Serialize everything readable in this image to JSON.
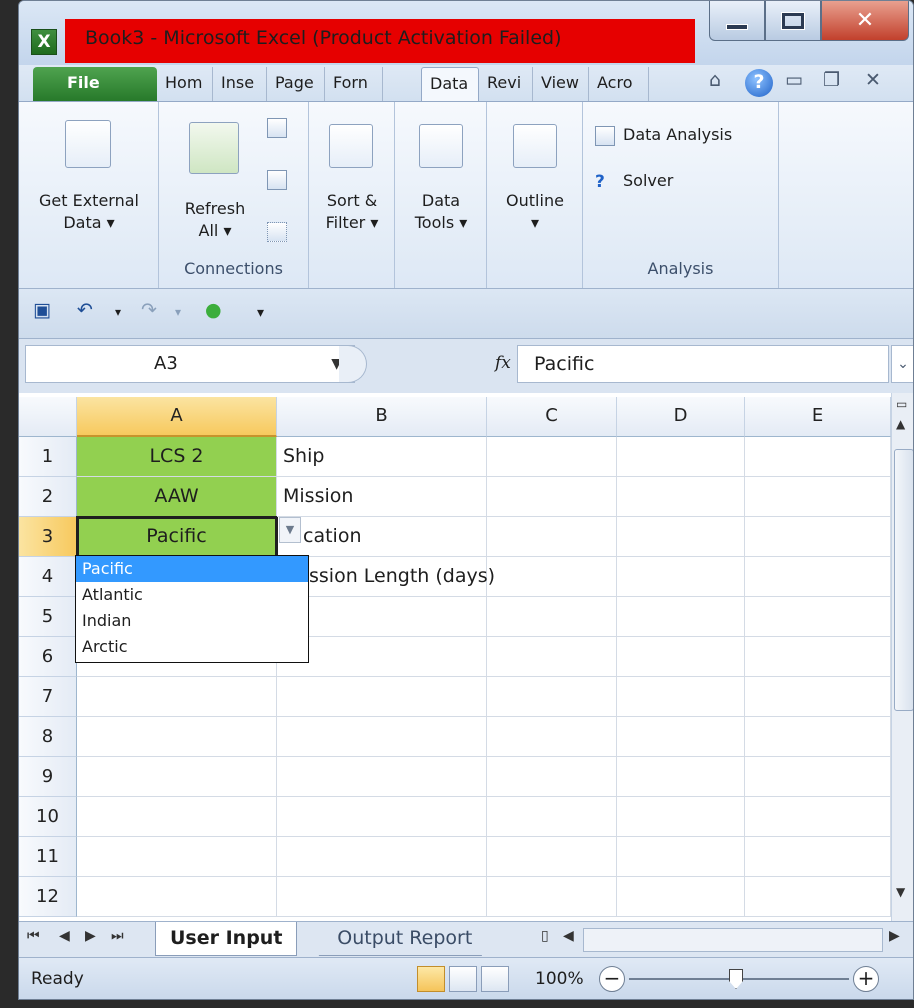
{
  "window": {
    "title": "Book3  -  Microsoft Excel (Product Activation Failed)",
    "app_icon": "X"
  },
  "ribbon_tabs": [
    "File",
    "Hom",
    "Inse",
    "Page",
    "Forn",
    "Data",
    "Revi",
    "View",
    "Acro"
  ],
  "active_tab": "Data",
  "ribbon": {
    "get_external_data": [
      "Get External",
      "Data ▾"
    ],
    "refresh_all": [
      "Refresh",
      "All ▾"
    ],
    "connections_label": "Connections",
    "sort_filter": [
      "Sort &",
      "Filter ▾"
    ],
    "data_tools": [
      "Data",
      "Tools ▾"
    ],
    "outline": [
      "Outline",
      "▾"
    ],
    "data_analysis": "Data Analysis",
    "solver": "Solver",
    "analysis_label": "Analysis"
  },
  "formula_bar": {
    "name_box": "A3",
    "fx_label": "fx",
    "value": "Pacific"
  },
  "grid": {
    "columns": [
      "A",
      "B",
      "C",
      "D",
      "E"
    ],
    "rows": [
      "1",
      "2",
      "3",
      "4",
      "5",
      "6",
      "7",
      "8",
      "9",
      "10",
      "11",
      "12"
    ],
    "selected_cell": "A3",
    "cells": {
      "A1": "LCS 2",
      "A2": "AAW",
      "A3": "Pacific",
      "B1": "Ship",
      "B2": "Mission",
      "B3": "cation",
      "B4": "ssion Length (days)"
    }
  },
  "validation_list": {
    "options": [
      "Pacific",
      "Atlantic",
      "Indian",
      "Arctic"
    ],
    "highlighted": "Pacific"
  },
  "sheets": {
    "tabs": [
      "User Input",
      "Output Report"
    ],
    "active": "User Input"
  },
  "status": {
    "mode": "Ready",
    "zoom": "100%",
    "zoom_level": 1.0
  },
  "colors": {
    "title_highlight": "#e60000",
    "green_fill": "#92d050",
    "file_tab": "#2e7d32",
    "list_highlight": "#3399ff"
  }
}
